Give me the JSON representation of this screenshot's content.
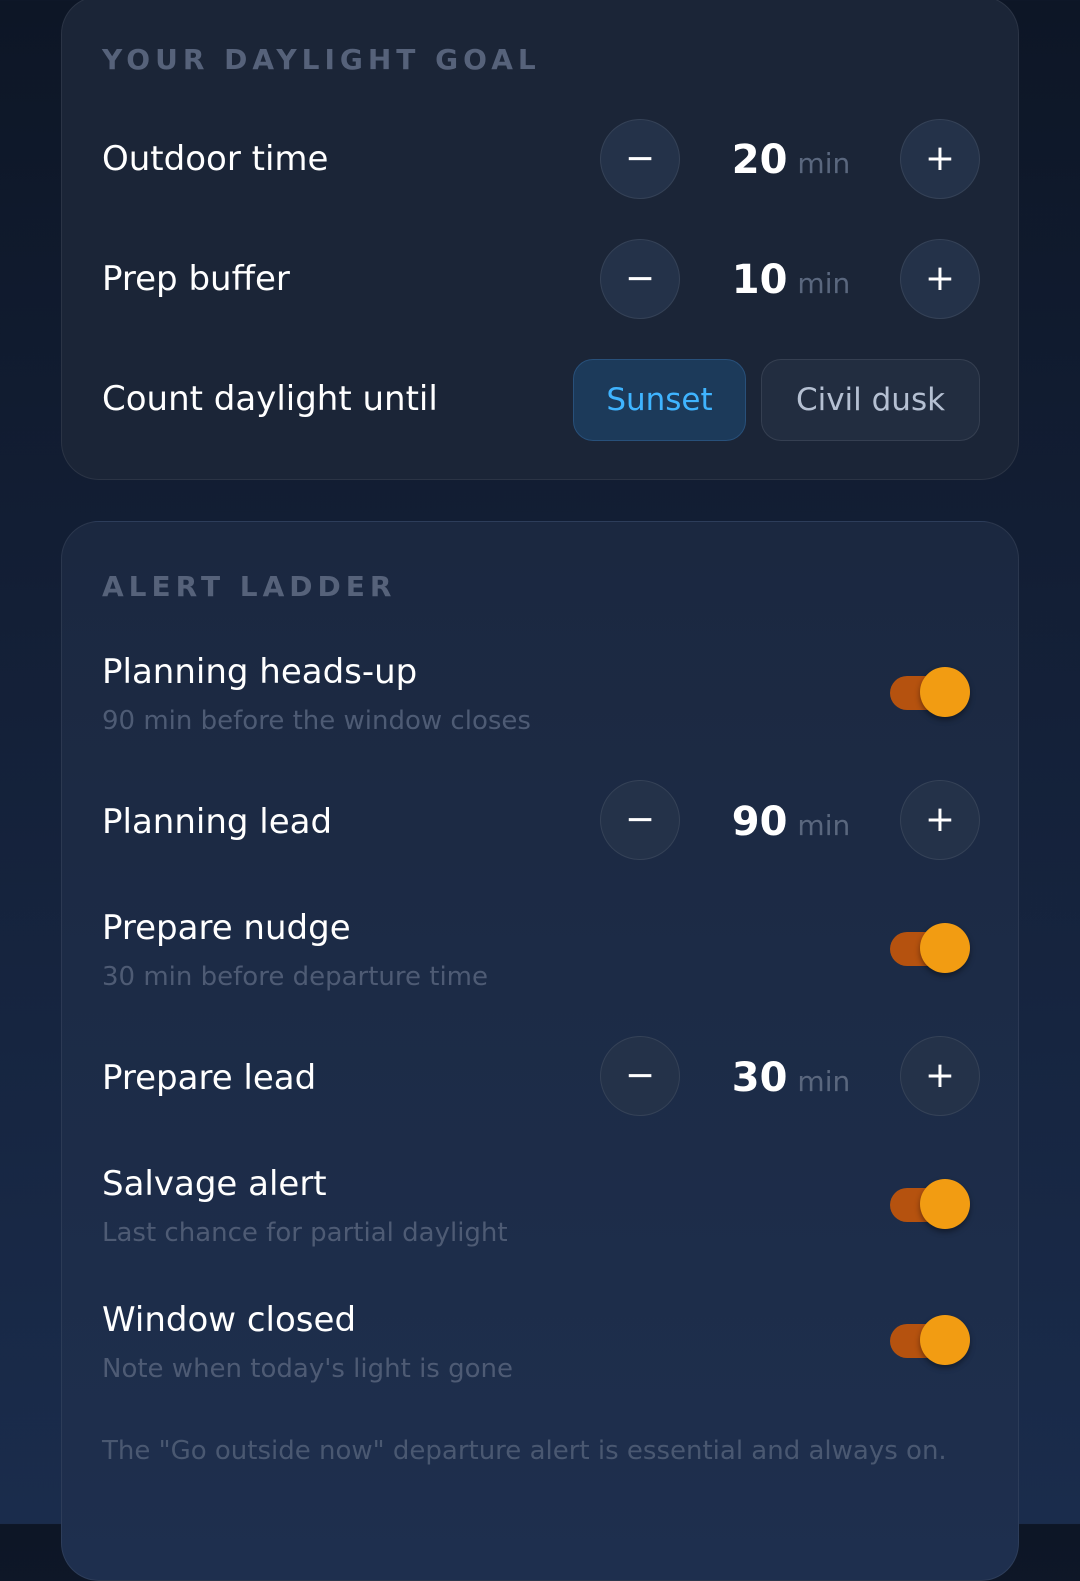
{
  "goal": {
    "title": "YOUR DAYLIGHT GOAL",
    "outdoor": {
      "label": "Outdoor time",
      "value": "20",
      "unit": "min",
      "minus": "−",
      "plus": "+"
    },
    "prep": {
      "label": "Prep buffer",
      "value": "10",
      "unit": "min",
      "minus": "−",
      "plus": "+"
    },
    "until": {
      "label": "Count daylight until",
      "options": [
        "Sunset",
        "Civil dusk"
      ],
      "selected": "Sunset"
    }
  },
  "ladder": {
    "title": "ALERT LADDER",
    "planning": {
      "label": "Planning heads-up",
      "sub": "90 min before the window closes",
      "enabled": true
    },
    "planning_lead": {
      "label": "Planning lead",
      "value": "90",
      "unit": "min",
      "minus": "−",
      "plus": "+"
    },
    "prepare": {
      "label": "Prepare nudge",
      "sub": "30 min before departure time",
      "enabled": true
    },
    "prepare_lead": {
      "label": "Prepare lead",
      "value": "30",
      "unit": "min",
      "minus": "−",
      "plus": "+"
    },
    "salvage": {
      "label": "Salvage alert",
      "sub": "Last chance for partial daylight",
      "enabled": true
    },
    "closed": {
      "label": "Window closed",
      "sub": "Note when today's light is gone",
      "enabled": true
    },
    "footnote": "The \"Go outside now\" departure alert is essential and always on."
  },
  "colors": {
    "accent_blue": "#3fb4ff",
    "toggle_knob": "#f29c12",
    "toggle_track": "#b5520f"
  }
}
